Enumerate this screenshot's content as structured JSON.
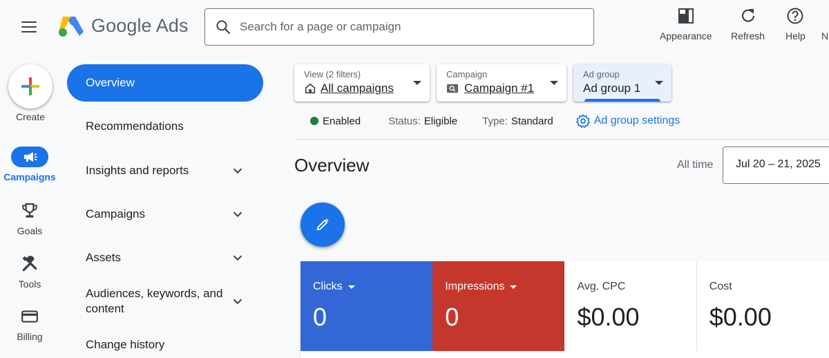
{
  "header": {
    "app_name": "Google Ads",
    "search_placeholder": "Search for a page or campaign",
    "actions": [
      {
        "label": "Appearance",
        "icon": "appearance-icon"
      },
      {
        "label": "Refresh",
        "icon": "refresh-icon"
      },
      {
        "label": "Help",
        "icon": "help-icon"
      },
      {
        "label": "N",
        "icon": "notifications-icon"
      }
    ]
  },
  "rail": {
    "create_label": "Create",
    "items": [
      {
        "label": "Campaigns",
        "icon": "megaphone-icon",
        "active": true
      },
      {
        "label": "Goals",
        "icon": "trophy-icon"
      },
      {
        "label": "Tools",
        "icon": "tools-icon"
      },
      {
        "label": "Billing",
        "icon": "credit-card-icon"
      }
    ]
  },
  "sidebar": {
    "items": [
      {
        "label": "Overview",
        "active": true
      },
      {
        "label": "Recommendations"
      },
      {
        "label": "Insights and reports",
        "expandable": true
      },
      {
        "label": "Campaigns",
        "expandable": true
      },
      {
        "label": "Assets",
        "expandable": true
      },
      {
        "label": "Audiences, keywords, and content",
        "expandable": true
      },
      {
        "label": "Change history"
      }
    ]
  },
  "filters": {
    "view": {
      "caption": "View (2 filters)",
      "value": "All campaigns"
    },
    "campaign": {
      "caption": "Campaign",
      "value": "Campaign #1"
    },
    "ad_group": {
      "caption": "Ad group",
      "value": "Ad group 1"
    }
  },
  "status": {
    "enabled": "Enabled",
    "status_label": "Status:",
    "status_value": "Eligible",
    "type_label": "Type:",
    "type_value": "Standard",
    "settings_link": "Ad group settings"
  },
  "main": {
    "title": "Overview",
    "range_label": "All time",
    "date_range": "Jul 20 – 21, 2025"
  },
  "metrics": [
    {
      "label": "Clicks",
      "value": "0",
      "color": "#3367d6",
      "dropdown": true
    },
    {
      "label": "Impressions",
      "value": "0",
      "color": "#c5372c",
      "dropdown": true
    },
    {
      "label": "Avg. CPC",
      "value": "$0.00"
    },
    {
      "label": "Cost",
      "value": "$0.00"
    }
  ],
  "colors": {
    "accent": "#1a73e8",
    "enabled_green": "#188038"
  }
}
